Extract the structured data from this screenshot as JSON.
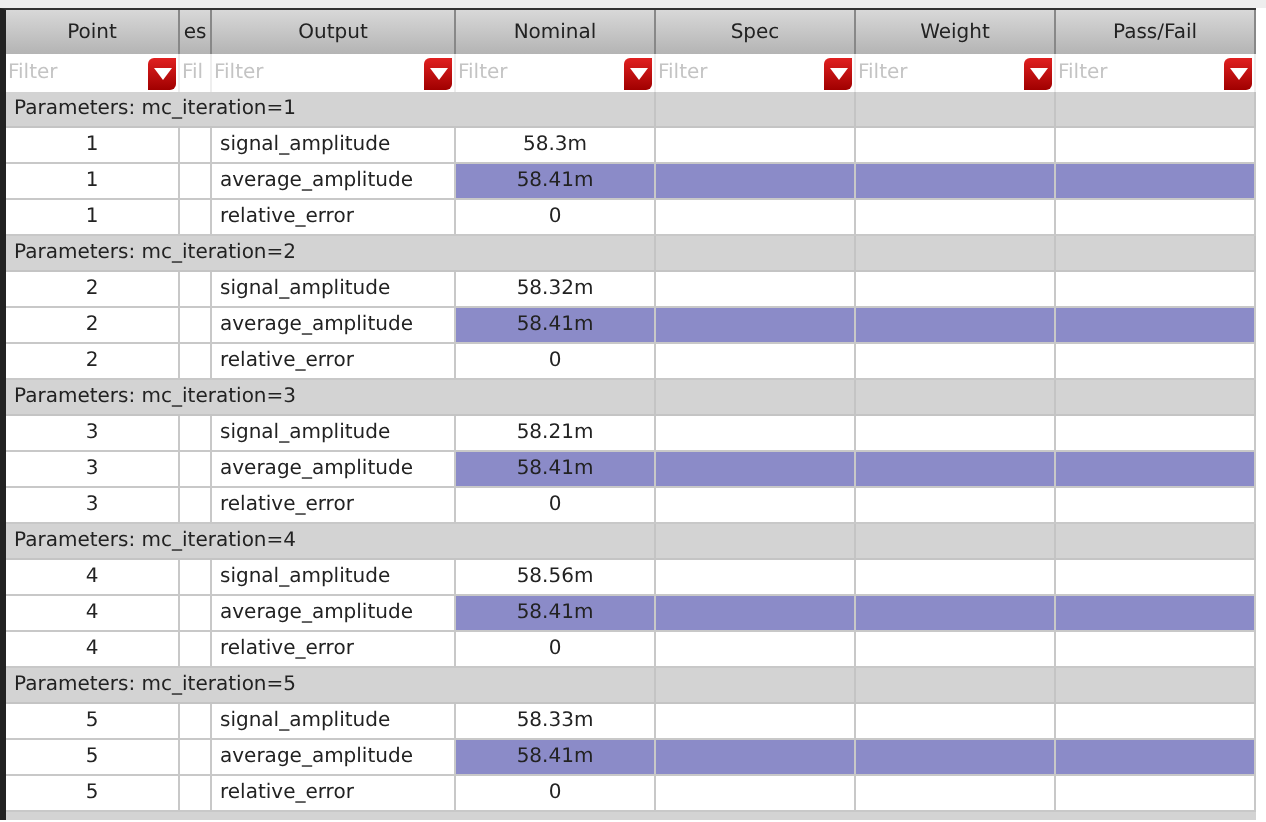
{
  "table": {
    "columns": [
      {
        "label": "Point"
      },
      {
        "label": "es"
      },
      {
        "label": "Output"
      },
      {
        "label": "Nominal"
      },
      {
        "label": "Spec"
      },
      {
        "label": "Weight"
      },
      {
        "label": "Pass/Fail"
      }
    ],
    "filters": [
      {
        "placeholder": "Filter",
        "dropdown": true
      },
      {
        "placeholder": "Fil",
        "dropdown": false
      },
      {
        "placeholder": "Filter",
        "dropdown": true
      },
      {
        "placeholder": "Filter",
        "dropdown": true
      },
      {
        "placeholder": "Filter",
        "dropdown": true
      },
      {
        "placeholder": "Filter",
        "dropdown": true
      },
      {
        "placeholder": "Filter",
        "dropdown": true
      }
    ],
    "groups": [
      {
        "label": "Parameters: mc_iteration=1",
        "rows": [
          {
            "point": "1",
            "output": "signal_amplitude",
            "nominal": "58.3m",
            "highlighted": false
          },
          {
            "point": "1",
            "output": "average_amplitude",
            "nominal": "58.41m",
            "highlighted": true
          },
          {
            "point": "1",
            "output": "relative_error",
            "nominal": "0",
            "highlighted": false
          }
        ]
      },
      {
        "label": "Parameters: mc_iteration=2",
        "rows": [
          {
            "point": "2",
            "output": "signal_amplitude",
            "nominal": "58.32m",
            "highlighted": false
          },
          {
            "point": "2",
            "output": "average_amplitude",
            "nominal": "58.41m",
            "highlighted": true
          },
          {
            "point": "2",
            "output": "relative_error",
            "nominal": "0",
            "highlighted": false
          }
        ]
      },
      {
        "label": "Parameters: mc_iteration=3",
        "rows": [
          {
            "point": "3",
            "output": "signal_amplitude",
            "nominal": "58.21m",
            "highlighted": false
          },
          {
            "point": "3",
            "output": "average_amplitude",
            "nominal": "58.41m",
            "highlighted": true
          },
          {
            "point": "3",
            "output": "relative_error",
            "nominal": "0",
            "highlighted": false
          }
        ]
      },
      {
        "label": "Parameters: mc_iteration=4",
        "rows": [
          {
            "point": "4",
            "output": "signal_amplitude",
            "nominal": "58.56m",
            "highlighted": false
          },
          {
            "point": "4",
            "output": "average_amplitude",
            "nominal": "58.41m",
            "highlighted": true
          },
          {
            "point": "4",
            "output": "relative_error",
            "nominal": "0",
            "highlighted": false
          }
        ]
      },
      {
        "label": "Parameters: mc_iteration=5",
        "rows": [
          {
            "point": "5",
            "output": "signal_amplitude",
            "nominal": "58.33m",
            "highlighted": false
          },
          {
            "point": "5",
            "output": "average_amplitude",
            "nominal": "58.41m",
            "highlighted": true
          },
          {
            "point": "5",
            "output": "relative_error",
            "nominal": "0",
            "highlighted": false
          }
        ]
      }
    ]
  }
}
